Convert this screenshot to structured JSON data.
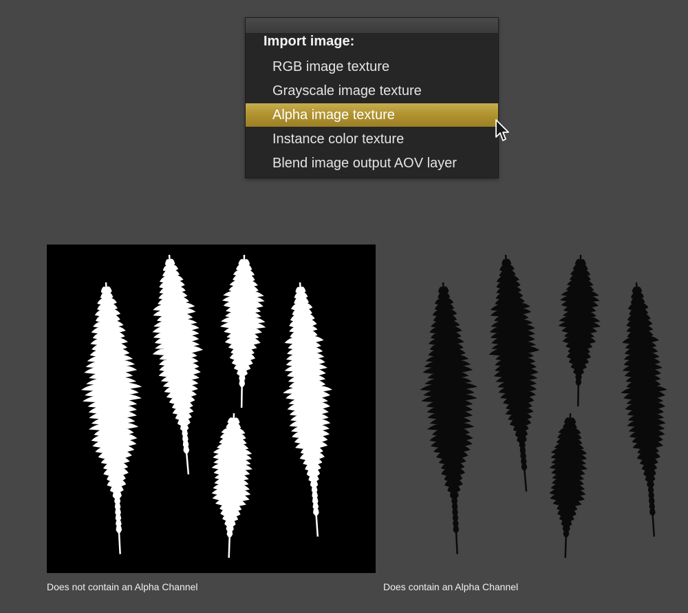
{
  "menu": {
    "header": "Import image:",
    "items": [
      {
        "label": "RGB image texture",
        "selected": false
      },
      {
        "label": "Grayscale image texture",
        "selected": false
      },
      {
        "label": "Alpha image texture",
        "selected": true
      },
      {
        "label": "Instance color texture",
        "selected": false
      },
      {
        "label": "Blend image output AOV layer",
        "selected": false
      }
    ]
  },
  "captions": {
    "left": "Does not contain an Alpha Channel",
    "right": "Does contain an Alpha Channel"
  },
  "colors": {
    "background": "#474747",
    "menu_bg": "#262626",
    "highlight": "#b29430",
    "fern_left": "#ffffff",
    "fern_right": "#0a0a0a"
  }
}
